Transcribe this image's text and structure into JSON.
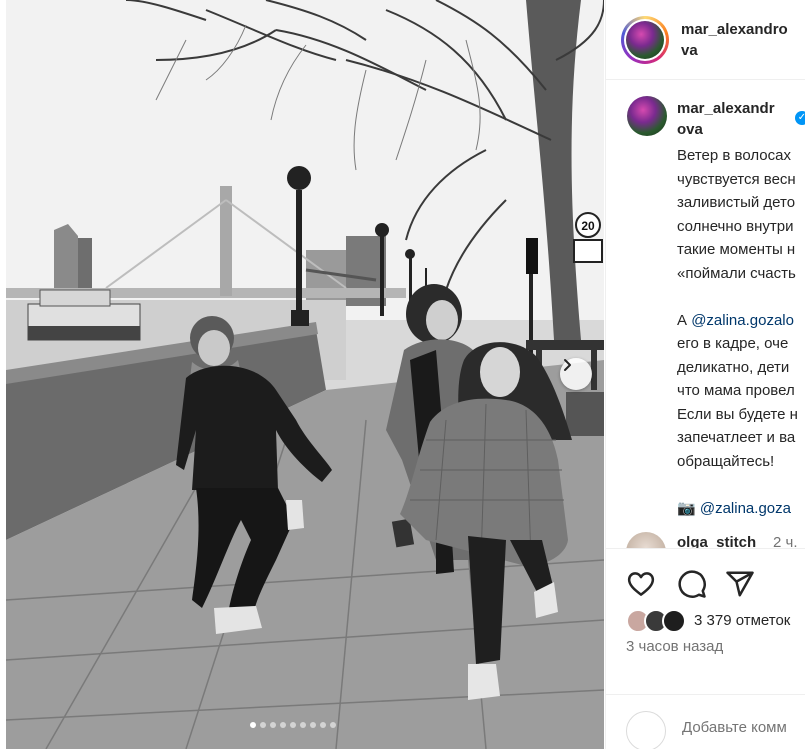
{
  "post": {
    "author": "mar_alexandrova",
    "author_line1": "mar_alexandro",
    "author_line2": "va",
    "caption_author_line1": "mar_alexandr",
    "caption_author_line2": "ova",
    "caption_lines": [
      "Ветер в волосах",
      "чувствуется весн",
      "заливистый дето",
      "солнечно внутри",
      "такие моменты н",
      "«поймали счасть"
    ],
    "caption_lines2_prefix": "А ",
    "caption_mention": "@zalina.gozalo",
    "caption_lines2": [
      "его в кадре, оче",
      "деликатно, дети",
      "что мама провел",
      "Если вы будете н",
      "запечатлеет и ва",
      "обращайтесь!"
    ],
    "camera_emoji": "📷",
    "camera_mention": "@zalina.goza"
  },
  "comment": {
    "user": "olga_stitch",
    "time": "2 ч."
  },
  "photo": {
    "sign_speed": "20",
    "carousel_dots": 9,
    "active_dot": 0
  },
  "actions": {
    "like_icon": "heart-icon",
    "comment_icon": "comment-icon",
    "share_icon": "share-icon",
    "likes_text": "3 379 отметок",
    "time_ago": "3 часов назад",
    "add_comment_placeholder": "Добавьте комм"
  },
  "colors": {
    "link": "#00376b",
    "verified": "#0095f6",
    "muted": "#737373"
  }
}
